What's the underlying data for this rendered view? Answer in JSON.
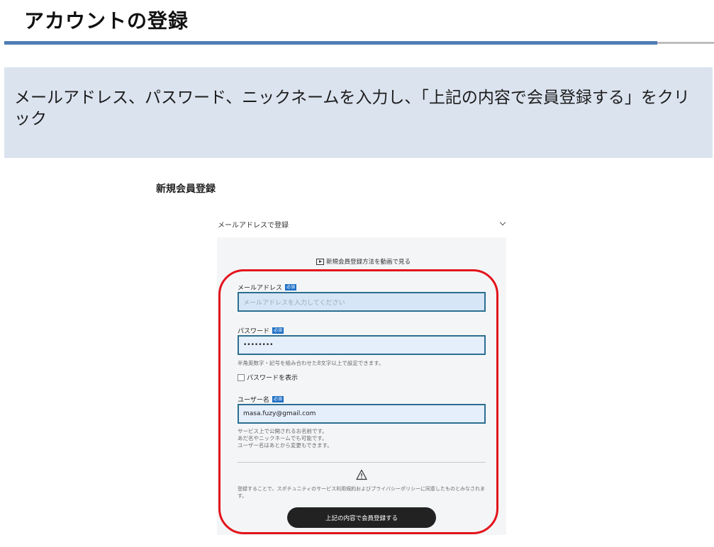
{
  "page": {
    "title": "アカウントの登録"
  },
  "instruction": {
    "text": "メールアドレス、パスワード、ニックネームを入力し、「上記の内容で会員登録する」をクリック"
  },
  "form": {
    "heading": "新規会員登録",
    "accordion_label": "メールアドレスで登録",
    "video_link": "新規会員登録方法を動画で見る",
    "required_badge": "必須",
    "email": {
      "label": "メールアドレス",
      "placeholder": "メールアドレスを入力してください"
    },
    "password": {
      "label": "パスワード",
      "value": "••••••••",
      "helper": "半角英数字・記号を組み合わせた8文字以上で設定できます。",
      "show_label": "パスワードを表示"
    },
    "username": {
      "label": "ユーザー名",
      "value": "masa.fuzy@gmail.com",
      "helper_lines": [
        "サービス上で公開されるお名前です。",
        "あだ名やニックネームでも可能です。",
        "ユーザー名はあとから変更もできます。"
      ]
    },
    "terms": "登録することで、スポチュニティのサービス利用規約およびプライバシーポリシーに同意したものとみなされます。",
    "submit_label": "上記の内容で会員登録する"
  },
  "colors": {
    "accent_rule": "#4f7db2",
    "instruction_bg": "#dbe3ef",
    "highlight": "#e3131b",
    "badge": "#1c6fc6",
    "button": "#222222"
  }
}
